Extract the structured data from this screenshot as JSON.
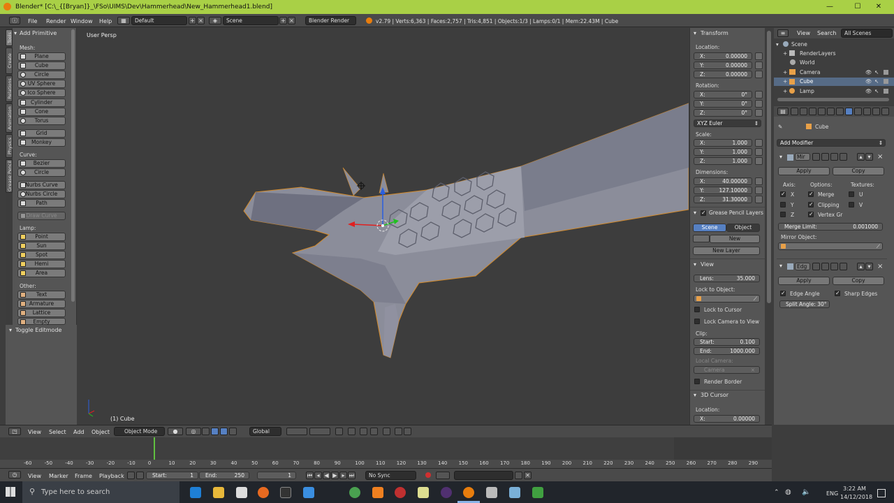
{
  "window": {
    "title": "Blender* [C:\\_{[Bryan]}_\\FSo\\UIMS\\Dev\\Hammerhead\\New_Hammerhead1.blend]",
    "minimize": "—",
    "maximize": "☐",
    "close": "✕"
  },
  "info": {
    "menus": [
      "File",
      "Render",
      "Window",
      "Help"
    ],
    "layout": "Default",
    "scene": "Scene",
    "engine": "Blender Render",
    "stats": "v2.79 | Verts:6,363 | Faces:2,757 | Tris:4,851 | Objects:1/3 | Lamps:0/1 | Mem:22.43M | Cube"
  },
  "tabs": [
    "Tools",
    "Create",
    "Relations",
    "Animation",
    "Physics",
    "Grease Pencil"
  ],
  "toolshelf": {
    "title": "Add Primitive",
    "mesh_label": "Mesh:",
    "mesh": [
      "Plane",
      "Cube",
      "Circle",
      "UV Sphere",
      "Ico Sphere",
      "Cylinder",
      "Cone",
      "Torus"
    ],
    "mesh2": [
      "Grid",
      "Monkey"
    ],
    "curve_label": "Curve:",
    "curve": [
      "Bezier",
      "Circle"
    ],
    "curve2": [
      "Nurbs Curve",
      "Nurbs Circle",
      "Path"
    ],
    "draw_curve": "Draw Curve",
    "lamp_label": "Lamp:",
    "lamp": [
      "Point",
      "Sun",
      "Spot",
      "Hemi",
      "Area"
    ],
    "other_label": "Other:",
    "other": [
      "Text",
      "Armature",
      "Lattice",
      "Empty"
    ],
    "toggle_editmode": "Toggle Editmode"
  },
  "viewport": {
    "view_name": "User Persp",
    "object_name": "(1) Cube"
  },
  "npanel": {
    "transform": "Transform",
    "location": "Location:",
    "loc": [
      {
        "l": "X:",
        "v": "0.00000"
      },
      {
        "l": "Y:",
        "v": "0.00000"
      },
      {
        "l": "Z:",
        "v": "0.00000"
      }
    ],
    "rotation": "Rotation:",
    "rot": [
      {
        "l": "X:",
        "v": "0°"
      },
      {
        "l": "Y:",
        "v": "0°"
      },
      {
        "l": "Z:",
        "v": "0°"
      }
    ],
    "rot_mode": "XYZ Euler",
    "scale": "Scale:",
    "scl": [
      {
        "l": "X:",
        "v": "1.000"
      },
      {
        "l": "Y:",
        "v": "1.000"
      },
      {
        "l": "Z:",
        "v": "1.000"
      }
    ],
    "dimensions": "Dimensions:",
    "dim": [
      {
        "l": "X:",
        "v": "40.00000"
      },
      {
        "l": "Y:",
        "v": "127.10000"
      },
      {
        "l": "Z:",
        "v": "31.30000"
      }
    ],
    "gp_layers": "Grease Pencil Layers",
    "gp_scene": "Scene",
    "gp_object": "Object",
    "gp_new": "New",
    "gp_new_layer": "New Layer",
    "view": "View",
    "lens_l": "Lens:",
    "lens_v": "35.000",
    "lock_to_object": "Lock to Object:",
    "lock_to_cursor": "Lock to Cursor",
    "lock_camera": "Lock Camera to View",
    "clip": "Clip:",
    "clip_start_l": "Start:",
    "clip_start_v": "0.100",
    "clip_end_l": "End:",
    "clip_end_v": "1000.000",
    "local_camera": "Local Camera:",
    "camera": "Camera",
    "render_border": "Render Border",
    "cursor": "3D Cursor",
    "cursor_location": "Location:",
    "cursor_x_l": "X:",
    "cursor_x_v": "0.00000"
  },
  "outliner": {
    "view": "View",
    "search": "Search",
    "filter": "All Scenes",
    "items": [
      "Scene",
      "RenderLayers",
      "World",
      "Camera",
      "Cube",
      "Lamp"
    ]
  },
  "props": {
    "context": "Cube",
    "add_modifier": "Add Modifier",
    "mod1_name": "Mir",
    "apply": "Apply",
    "copy": "Copy",
    "axis": "Axis:",
    "options": "Options:",
    "textures": "Textures:",
    "x": "X",
    "y": "Y",
    "z": "Z",
    "merge": "Merge",
    "clipping": "Clipping",
    "vertex_gr": "Vertex Gr",
    "u": "U",
    "v": "V",
    "merge_limit_l": "Merge Limit:",
    "merge_limit_v": "0.001000",
    "mirror_object": "Mirror Object:",
    "mod2_name": "Edg",
    "edge_angle": "Edge Angle",
    "sharp_edges": "Sharp Edges",
    "split_angle": "Split Angle: 30°"
  },
  "vheader": {
    "view": "View",
    "select": "Select",
    "add": "Add",
    "object": "Object",
    "mode": "Object Mode",
    "orientation": "Global"
  },
  "timeline": {
    "ticks": [
      "-60",
      "-50",
      "-40",
      "-30",
      "-20",
      "-10",
      "0",
      "10",
      "20",
      "30",
      "40",
      "50",
      "60",
      "70",
      "80",
      "90",
      "100",
      "110",
      "120",
      "130",
      "140",
      "150",
      "160",
      "170",
      "180",
      "190",
      "200",
      "210",
      "220",
      "230",
      "240",
      "250",
      "260",
      "270",
      "280",
      "290"
    ],
    "view": "View",
    "marker": "Marker",
    "frame": "Frame",
    "playback": "Playback",
    "start_l": "Start:",
    "start_v": "1",
    "end_l": "End:",
    "end_v": "250",
    "current": "1",
    "sync": "No Sync"
  },
  "taskbar": {
    "search": "Type here to search",
    "time": "3:22 AM",
    "date": "14/12/2018",
    "lang": "ENG"
  }
}
